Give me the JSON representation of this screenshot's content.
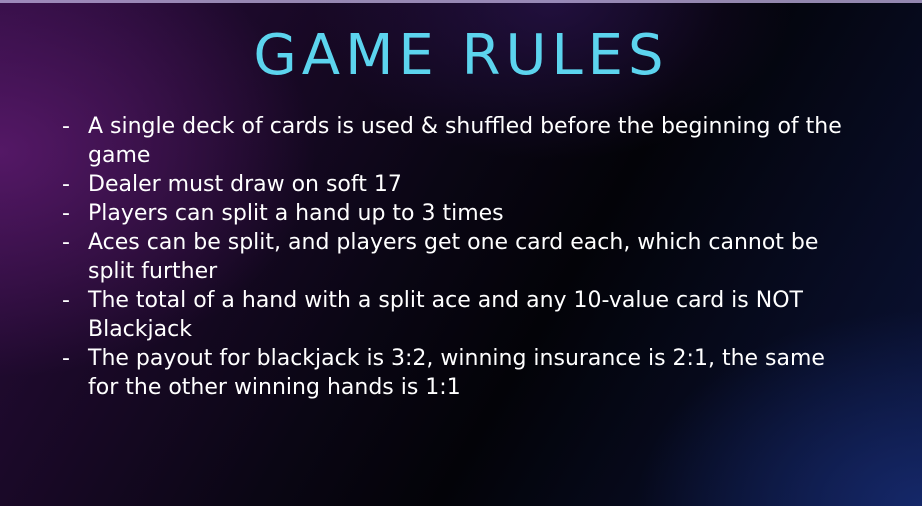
{
  "title": "GAME RULES",
  "rules": [
    {
      "bullet": "-",
      "text": "A single deck of cards is used & shuffled before the beginning of the game"
    },
    {
      "bullet": "-",
      "text": "Dealer must draw on soft 17"
    },
    {
      "bullet": "-",
      "text": "Players can split a hand up to 3 times"
    },
    {
      "bullet": "-",
      "text": "Aces can be split, and players get one card each, which cannot be split further"
    },
    {
      "bullet": "-",
      "text": "The total of a hand with a split ace and any 10-value card is NOT Blackjack"
    },
    {
      "bullet": "-",
      "text": "The payout for blackjack is 3:2, winning insurance is 2:1, the same for the other winning hands is 1:1"
    }
  ],
  "colors": {
    "title": "#5cd4ee",
    "text": "#ffffff",
    "background_dark": "#030308",
    "background_purple": "#5c1a6e",
    "background_blue": "#162a6e"
  }
}
